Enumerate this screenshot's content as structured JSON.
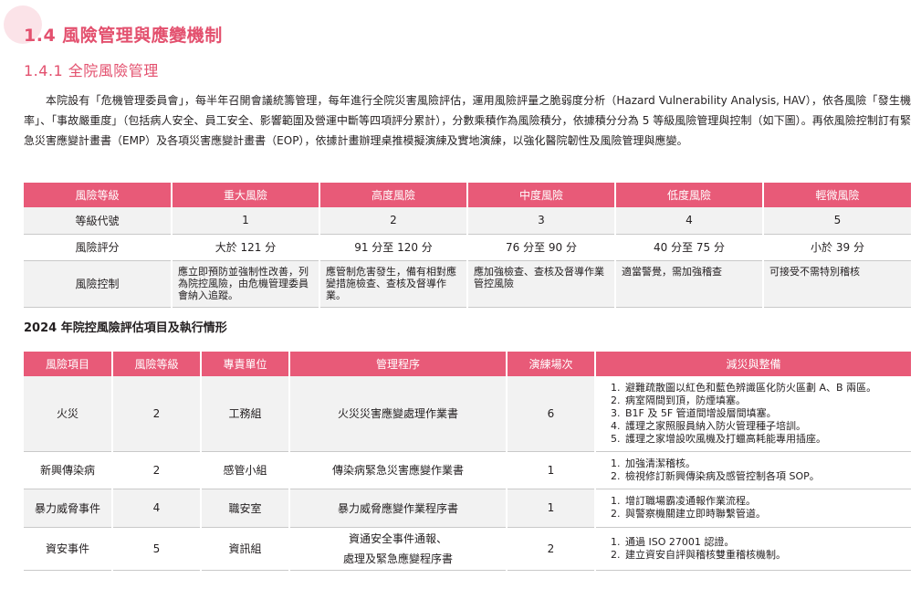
{
  "section_title": "1.4 風險管理與應變機制",
  "subsection_title": "1.4.1 全院風險管理",
  "paragraph": "本院設有「危機管理委員會」，每半年召開會議統籌管理，每年進行全院災害風險評估，運用風險評量之脆弱度分析（Hazard Vulnerability Analysis, HAV），依各風險「發生機率」、「事故嚴重度」（包括病人安全、員工安全、影響範圍及營運中斷等四項評分累計），分數乘積作為風險積分，依據積分分為 5 等級風險管理與控制（如下圖）。再依風險控制訂有緊急災害應變計畫書（EMP）及各項災害應變計畫書（EOP），依據計畫辦理桌推模擬演練及實地演練，以強化醫院韌性及風險管理與應變。",
  "risk_table": {
    "headers": [
      "風險等級",
      "重大風險",
      "高度風險",
      "中度風險",
      "低度風險",
      "輕微風險"
    ],
    "rows": [
      {
        "label": "等級代號",
        "cells": [
          "1",
          "2",
          "3",
          "4",
          "5"
        ]
      },
      {
        "label": "風險評分",
        "cells": [
          "大於 121 分",
          "91 分至 120 分",
          "76 分至 90 分",
          "40 分至 75 分",
          "小於 39 分"
        ]
      },
      {
        "label": "風險控制",
        "cells": [
          "應立即預防並強制性改善，列為院控風險，由危機管理委員會納入追蹤。",
          "應管制危害發生，備有相對應變措施檢查、查核及督導作業。",
          "應加強檢查、查核及督導作業管控風險",
          "適當警覺，需加強稽查",
          "可接受不需特別稽核"
        ]
      }
    ]
  },
  "table2_title": "2024 年院控風險評估項目及執行情形",
  "exec_table": {
    "headers": [
      "風險項目",
      "風險等級",
      "專責單位",
      "管理程序",
      "演練場次",
      "減災與整備"
    ],
    "rows": [
      {
        "item": "火災",
        "level": "2",
        "unit": "工務組",
        "procedure": "火災災害應變處理作業書",
        "procedure2": "",
        "drills": "6",
        "actions": [
          "避難疏散圖以紅色和藍色辨識區化防火區劃 A、B 兩區。",
          "病室隔間到頂，防煙填塞。",
          "B1F 及 5F 管道間增設層間填塞。",
          "護理之家照服員納入防火管理種子培訓。",
          "護理之家增設吹風機及打蠟高耗能專用插座。"
        ]
      },
      {
        "item": "新興傳染病",
        "level": "2",
        "unit": "感管小組",
        "procedure": "傳染病緊急災害應變作業書",
        "procedure2": "",
        "drills": "1",
        "actions": [
          "加強清潔稽核。",
          "檢視修訂新興傳染病及感管控制各項 SOP。"
        ]
      },
      {
        "item": "暴力威脅事件",
        "level": "4",
        "unit": "職安室",
        "procedure": "暴力威脅應變作業程序書",
        "procedure2": "",
        "drills": "1",
        "actions": [
          "增訂職場霸凌通報作業流程。",
          "與警察機關建立即時聯繫管道。"
        ]
      },
      {
        "item": "資安事件",
        "level": "5",
        "unit": "資訊組",
        "procedure": "資通安全事件通報、",
        "procedure2": "處理及緊急應變程序書",
        "drills": "2",
        "actions": [
          "通過 ISO 27001 認證。",
          "建立資安自評與稽核雙重稽核機制。"
        ]
      }
    ]
  }
}
